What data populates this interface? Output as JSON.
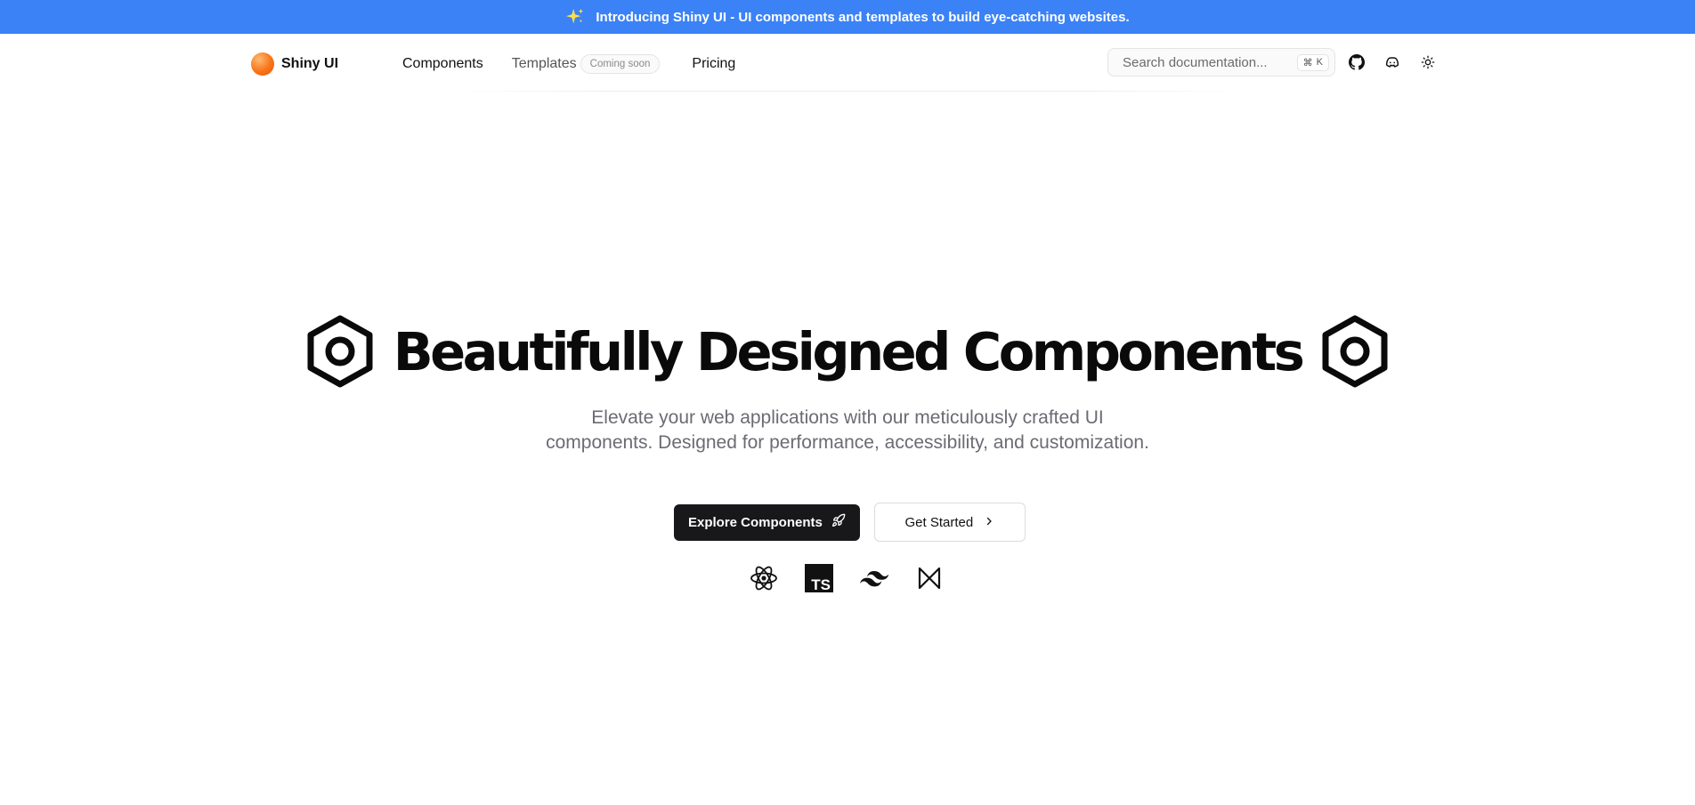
{
  "announcement": {
    "text": "Introducing Shiny UI - UI components and templates to build eye-catching websites.",
    "icon": "sparkles-icon"
  },
  "brand": {
    "name": "Shiny UI",
    "logo_colors": [
      "#fdba74",
      "#f97316",
      "#ea580c"
    ]
  },
  "nav": {
    "items": [
      {
        "label": "Components"
      },
      {
        "label": "Templates",
        "badge": "Coming soon"
      },
      {
        "label": "Pricing"
      }
    ]
  },
  "search": {
    "placeholder": "Search documentation...",
    "shortcut_symbol": "⌘",
    "shortcut_key": "K"
  },
  "header_icons": [
    "github-icon",
    "discord-icon",
    "sun-icon"
  ],
  "hero": {
    "title": "Beautifully Designed Components",
    "subtitle": "Elevate your web applications with our meticulously crafted UI components. Designed for performance, accessibility, and customization.",
    "primary_cta": "Explore Components",
    "secondary_cta": "Get Started",
    "decor_icons": [
      "hexagon-nut-icon",
      "hexagon-nut-icon"
    ]
  },
  "tech_icons": [
    {
      "name": "react-icon"
    },
    {
      "name": "typescript-icon",
      "text": "TS"
    },
    {
      "name": "tailwind-icon"
    },
    {
      "name": "framer-motion-icon"
    }
  ],
  "colors": {
    "banner": "#3b82f6",
    "primary_button": "#18181b",
    "subtitle_text": "#6b6b73",
    "spark": "#fde047"
  }
}
